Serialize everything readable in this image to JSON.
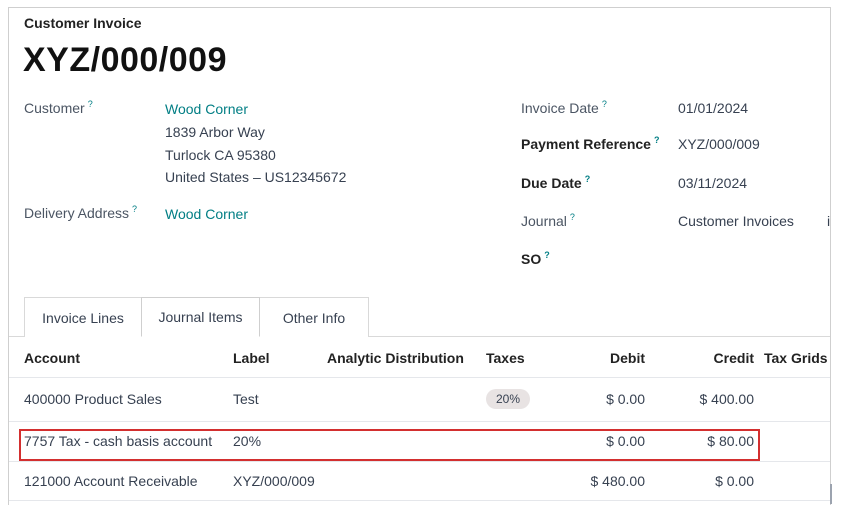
{
  "header": {
    "document_type": "Customer Invoice",
    "document_number": "XYZ/000/009"
  },
  "left_fields": {
    "customer_label": "Customer",
    "customer_name": "Wood Corner",
    "address_line1": "1839 Arbor Way",
    "address_line2": "Turlock CA 95380",
    "address_line3": "United States – US12345672",
    "delivery_label": "Delivery Address",
    "delivery_value": "Wood Corner"
  },
  "right_fields": {
    "invoice_date_label": "Invoice Date",
    "invoice_date_value": "01/01/2024",
    "payment_ref_label": "Payment Reference",
    "payment_ref_value": "XYZ/000/009",
    "due_date_label": "Due Date",
    "due_date_value": "03/11/2024",
    "journal_label": "Journal",
    "journal_value": "Customer Invoices",
    "so_label": "SO",
    "cut_off_glyph": "i"
  },
  "help_mark": "?",
  "tabs": [
    {
      "label": "Invoice Lines",
      "active": false
    },
    {
      "label": "Journal Items",
      "active": true
    },
    {
      "label": "Other Info",
      "active": false
    }
  ],
  "table": {
    "headers": {
      "account": "Account",
      "label": "Label",
      "analytic": "Analytic Distribution",
      "taxes": "Taxes",
      "debit": "Debit",
      "credit": "Credit",
      "tax_grids": "Tax Grids"
    },
    "rows": [
      {
        "account": "400000 Product Sales",
        "label": "Test",
        "taxes": "20%",
        "debit": "$ 0.00",
        "credit": "$ 400.00"
      },
      {
        "account": "7757 Tax - cash basis account",
        "label": "20%",
        "taxes": "",
        "debit": "$ 0.00",
        "credit": "$ 80.00"
      },
      {
        "account": "121000 Account Receivable",
        "label": "XYZ/000/009",
        "taxes": "",
        "debit": "$ 480.00",
        "credit": "$ 0.00"
      }
    ]
  },
  "colors": {
    "link": "#017e84",
    "highlight_border": "#d32f2f",
    "badge_bg": "#e8e3e3"
  }
}
